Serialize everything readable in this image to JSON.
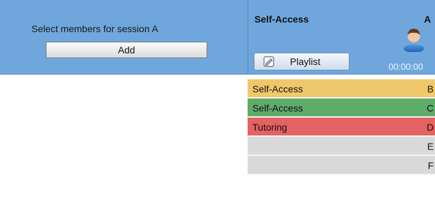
{
  "left": {
    "select_label": "Select members for session  A",
    "add_button": "Add"
  },
  "session": {
    "name": "Self-Access",
    "letter": "A",
    "playlist_button": "Playlist",
    "timer": "00:00:00"
  },
  "rows": [
    {
      "name": "Self-Access",
      "letter": "B",
      "color": "#f0c86c"
    },
    {
      "name": "Self-Access",
      "letter": "C",
      "color": "#5fab6a"
    },
    {
      "name": "Tutoring",
      "letter": "D",
      "color": "#e46262"
    },
    {
      "name": "",
      "letter": "E",
      "color": "#d9d9d9"
    },
    {
      "name": "",
      "letter": "F",
      "color": "#d9d9d9"
    }
  ],
  "icons": {
    "avatar": "user-avatar-icon",
    "playlist": "playlist-icon"
  }
}
